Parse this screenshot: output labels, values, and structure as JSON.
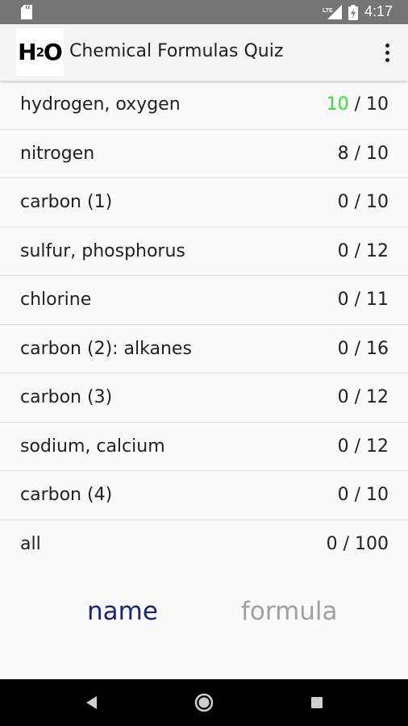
{
  "status_bar": {
    "time": "4:17",
    "network": "LTE",
    "icons": [
      "sd-card-icon",
      "lte-signal-icon",
      "battery-icon"
    ]
  },
  "app_bar": {
    "logo_main": "H",
    "logo_sub": "2",
    "logo_tail": "O",
    "title": "Chemical Formulas Quiz",
    "menu_icon": "overflow-menu-icon"
  },
  "quizzes": [
    {
      "label": "hydrogen, oxygen",
      "score": "10",
      "total": "/ 10",
      "complete": true
    },
    {
      "label": "nitrogen",
      "score": "8",
      "total": "/ 10",
      "complete": false
    },
    {
      "label": "carbon (1)",
      "score": "0",
      "total": "/ 10",
      "complete": false
    },
    {
      "label": "sulfur, phosphorus",
      "score": "0",
      "total": "/ 12",
      "complete": false
    },
    {
      "label": "chlorine",
      "score": "0",
      "total": "/ 11",
      "complete": false
    },
    {
      "label": "carbon (2): alkanes",
      "score": "0",
      "total": "/ 16",
      "complete": false
    },
    {
      "label": "carbon (3)",
      "score": "0",
      "total": "/ 12",
      "complete": false
    },
    {
      "label": "sodium, calcium",
      "score": "0",
      "total": "/ 12",
      "complete": false
    },
    {
      "label": "carbon (4)",
      "score": "0",
      "total": "/ 10",
      "complete": false
    },
    {
      "label": "all",
      "score": "0",
      "total": "/ 100",
      "complete": false
    }
  ],
  "mode": {
    "name_label": "name",
    "formula_label": "formula",
    "selected": "name"
  },
  "colors": {
    "complete_score": "#2ee62e",
    "selected_mode": "#1a237e",
    "unselected_mode": "#a0a0a0",
    "status_bar": "#757575"
  },
  "nav_bar": {
    "icons": [
      "back-icon",
      "home-icon",
      "recents-icon"
    ]
  }
}
